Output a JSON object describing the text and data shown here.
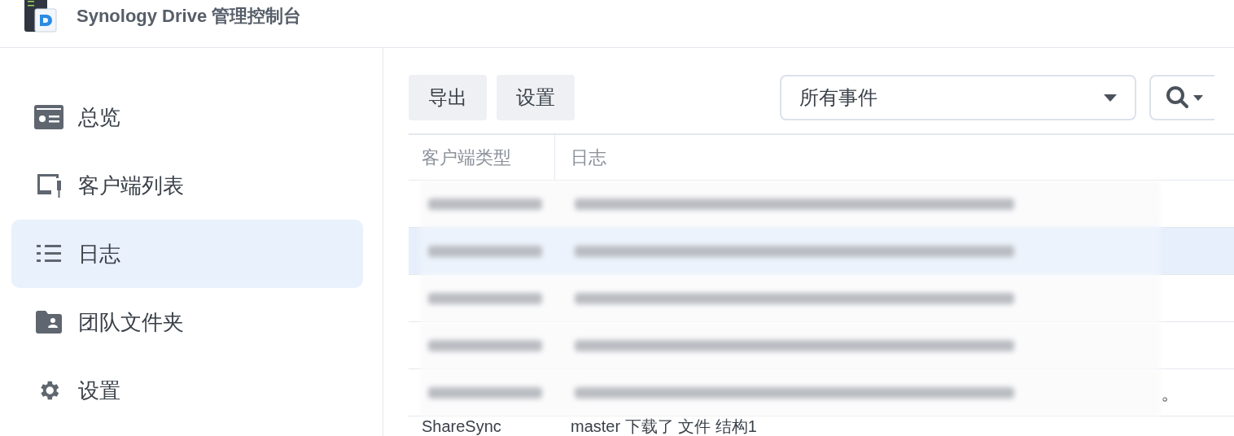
{
  "header": {
    "title": "Synology Drive 管理控制台"
  },
  "sidebar": {
    "items": [
      {
        "label": "总览",
        "kind": "overview",
        "selected": false
      },
      {
        "label": "客户端列表",
        "kind": "clients",
        "selected": false
      },
      {
        "label": "日志",
        "kind": "log",
        "selected": true
      },
      {
        "label": "团队文件夹",
        "kind": "team",
        "selected": false
      },
      {
        "label": "设置",
        "kind": "settings",
        "selected": false
      }
    ]
  },
  "toolbar": {
    "buttons": [
      "导出",
      "设置"
    ],
    "filter": {
      "value": "所有事件"
    }
  },
  "table": {
    "columns": [
      "客户端类型",
      "日志"
    ],
    "rows": [
      {
        "kind": "blurred",
        "selected": false
      },
      {
        "kind": "blurred",
        "selected": true
      },
      {
        "kind": "blurred",
        "selected": false
      },
      {
        "kind": "blurred",
        "selected": false
      },
      {
        "kind": "blurred",
        "selected": false,
        "visible_tail": "。"
      },
      {
        "kind": "text",
        "selected": false,
        "cells": [
          "ShareSync",
          "master 下载了 文件 结构1"
        ]
      }
    ]
  }
}
